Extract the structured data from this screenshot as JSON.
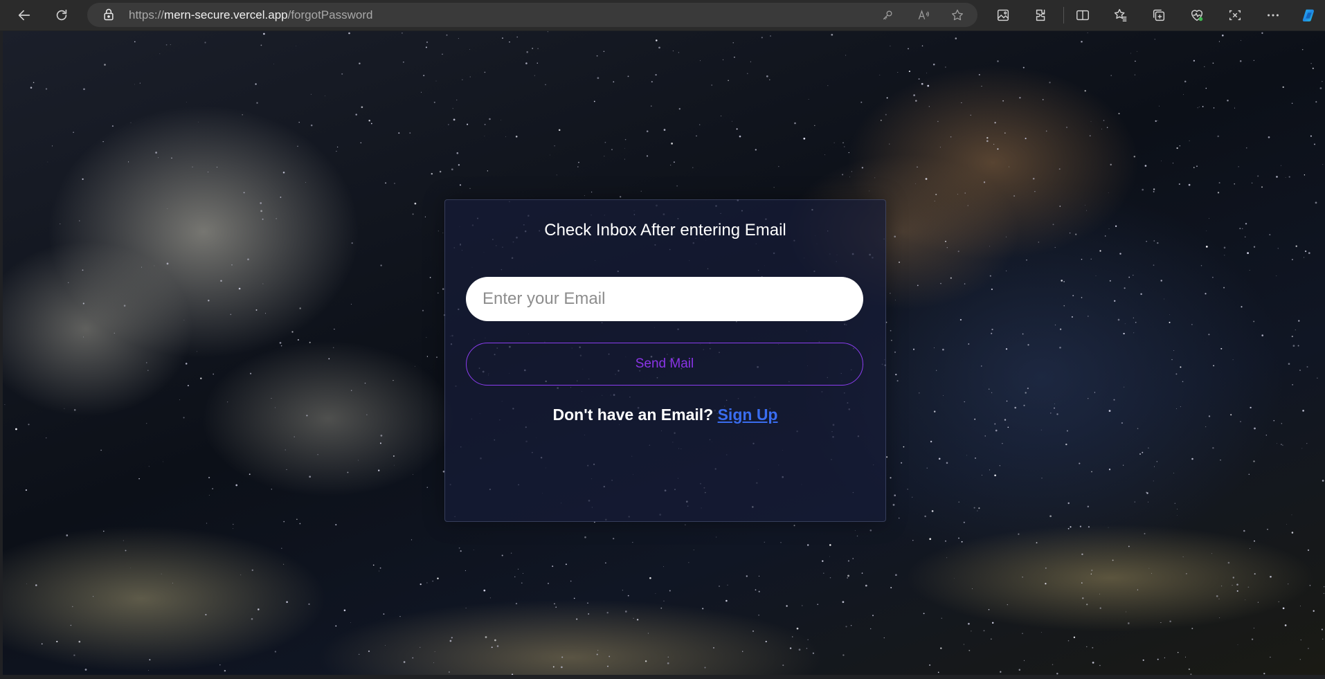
{
  "browser": {
    "url_scheme": "https://",
    "url_host": "mern-secure.vercel.app",
    "url_path": "/forgotPassword",
    "toolbar_icons": [
      "back-icon",
      "refresh-icon",
      "lock-icon",
      "key-icon",
      "read-aloud-icon",
      "favorite-star-icon",
      "image-icon",
      "extensions-icon",
      "split-screen-icon",
      "favorites-icon",
      "collections-icon",
      "performance-icon",
      "screenshot-icon",
      "more-icon",
      "copilot-icon"
    ]
  },
  "page": {
    "title": "Check Inbox After entering Email",
    "email_placeholder": "Enter your Email",
    "email_value": "",
    "send_button_label": "Send Mail",
    "signup_prompt": "Don't have an Email?",
    "signup_link_label": "Sign Up"
  },
  "colors": {
    "button_accent": "#8a34e6",
    "link": "#3a6df0",
    "card_bg": "#161c38"
  }
}
